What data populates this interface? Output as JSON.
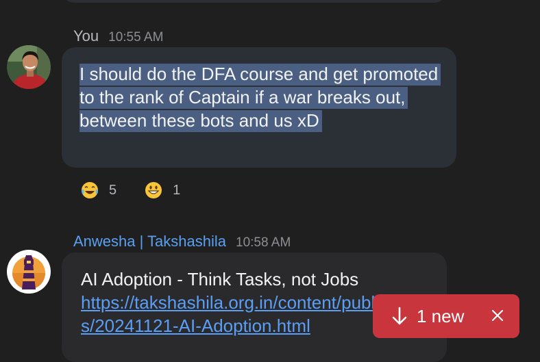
{
  "messages": [
    {
      "sender": "You",
      "time": "10:55 AM",
      "text": "I should do the DFA course and get promoted to the rank of Captain if a war breaks out, between these bots and us xD",
      "reactions": [
        {
          "emoji": "face-with-tears-of-joy",
          "count": "5"
        },
        {
          "emoji": "grinning-face",
          "count": "1"
        }
      ]
    },
    {
      "sender": "Anwesha | Takshashila",
      "time": "10:58 AM",
      "text": "AI Adoption - Think Tasks, not Jobs",
      "link": "https://takshashila.org.in/content/publications/20241121-AI-Adoption.html"
    }
  ],
  "new_messages_button": {
    "label": "1 new",
    "color": "#c9353c"
  },
  "colors": {
    "background": "#1f1f20",
    "own_bubble": "#2b2f36",
    "other_bubble": "#2a2a2c",
    "selection": "#4b5f82",
    "link": "#5a9ef5"
  }
}
